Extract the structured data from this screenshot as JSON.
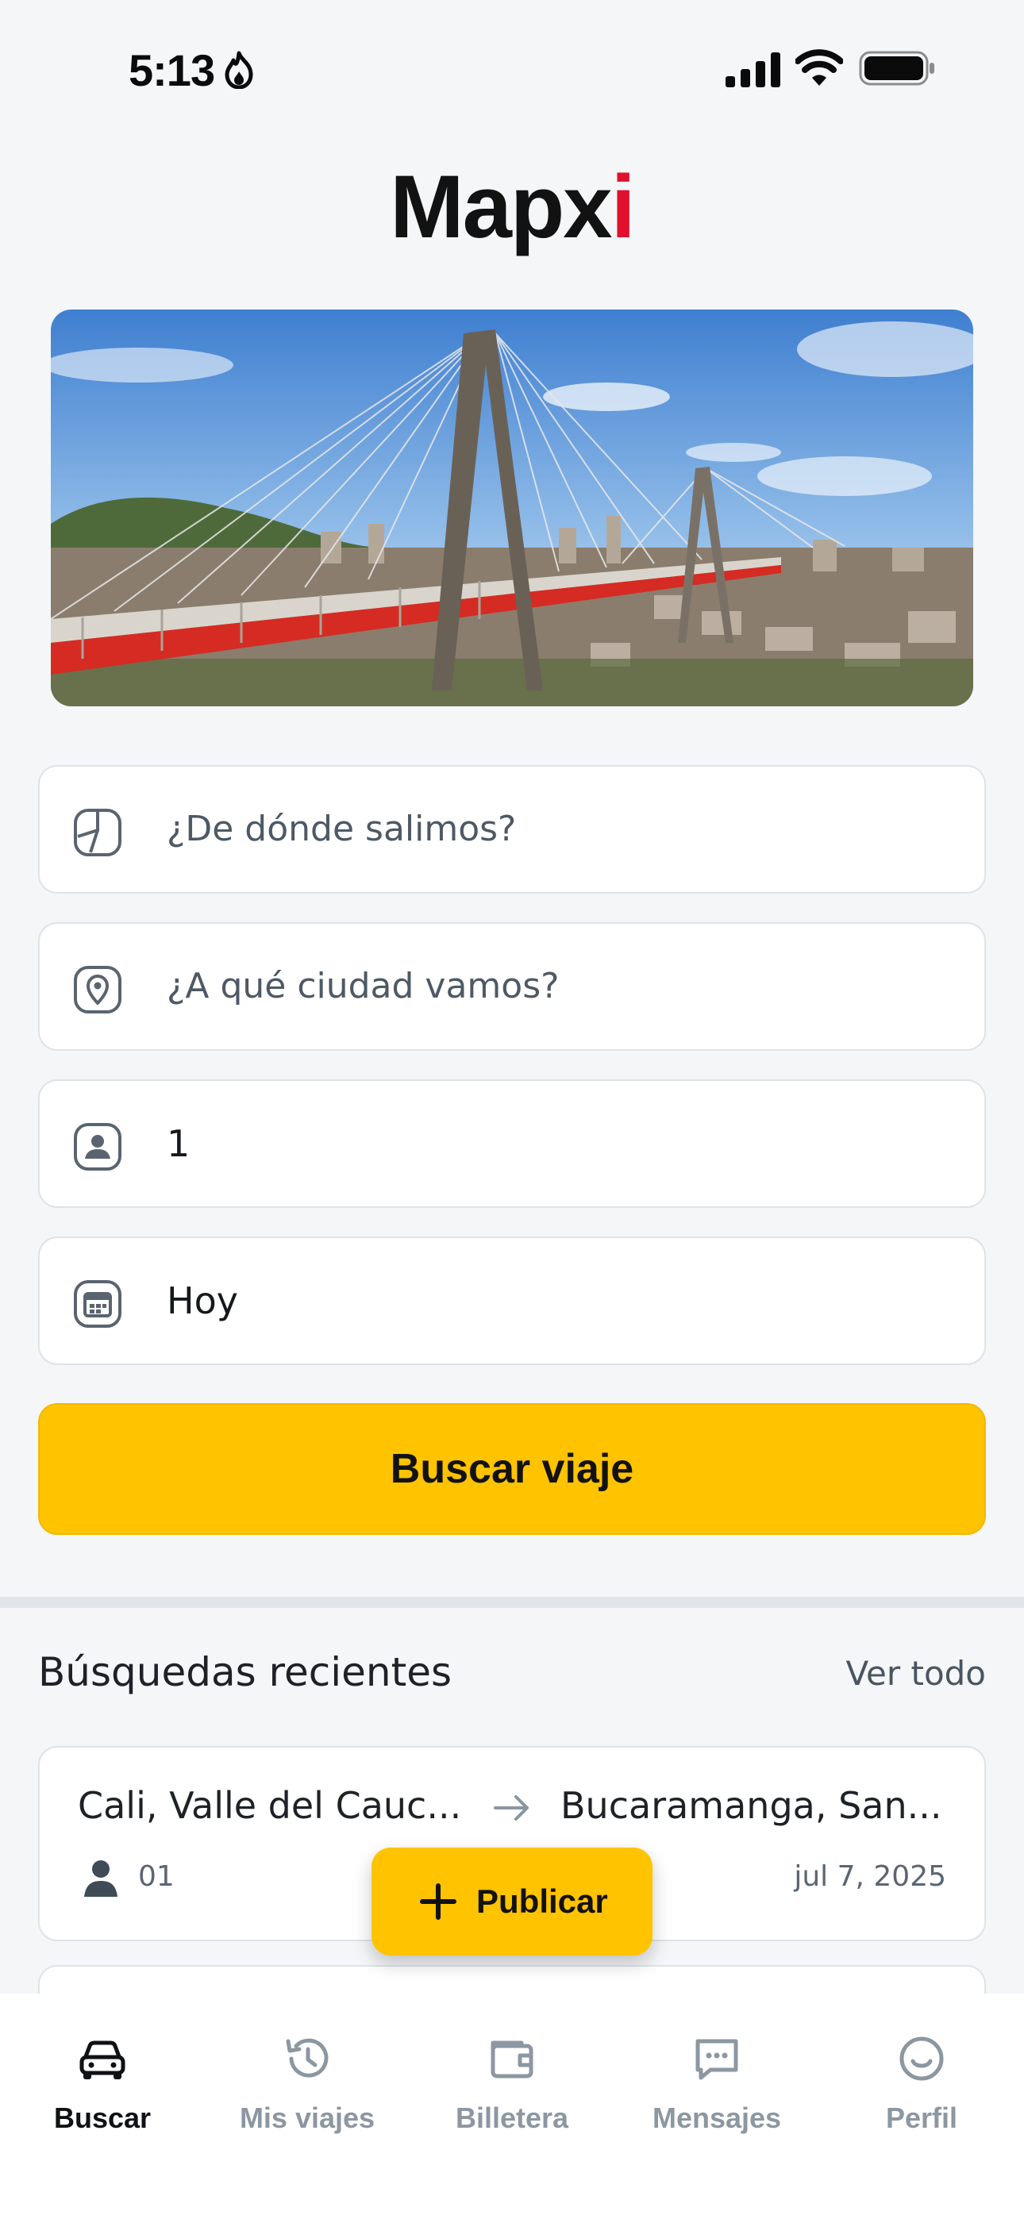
{
  "status_bar": {
    "time": "5:13"
  },
  "brand": {
    "name_main": "Mapx",
    "name_accent": "i",
    "accent_color": "#e0102e"
  },
  "hero": {
    "image": "Puente Cesar Gaviria bridge over city (illustration)"
  },
  "form": {
    "origin": {
      "placeholder": "¿De dónde salimos?",
      "icon": "compass-icon"
    },
    "destination": {
      "placeholder": "¿A qué ciudad vamos?",
      "icon": "location-pin-icon"
    },
    "passengers": {
      "value": "1",
      "icon": "person-badge-icon"
    },
    "date": {
      "value": "Hoy",
      "icon": "calendar-icon"
    },
    "submit_label": "Buscar viaje",
    "primary_color": "#ffc300"
  },
  "recent": {
    "title": "Búsquedas recientes",
    "view_all": "Ver todo",
    "items": [
      {
        "from": "Cali, Valle del Cauc...",
        "to": "Bucaramanga, San...",
        "passengers": "01",
        "date": "jul 7, 2025"
      }
    ]
  },
  "fab": {
    "label": "Publicar",
    "icon": "plus-icon"
  },
  "tabs": [
    {
      "label": "Buscar",
      "icon": "car-icon",
      "active": true
    },
    {
      "label": "Mis viajes",
      "icon": "history-icon",
      "active": false
    },
    {
      "label": "Billetera",
      "icon": "wallet-icon",
      "active": false
    },
    {
      "label": "Mensajes",
      "icon": "message-icon",
      "active": false
    },
    {
      "label": "Perfil",
      "icon": "smile-icon",
      "active": false
    }
  ]
}
